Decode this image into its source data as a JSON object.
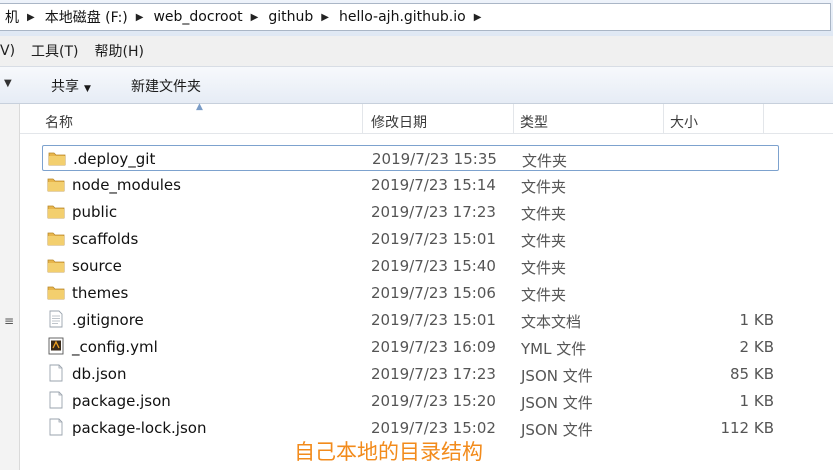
{
  "address": {
    "crumbs": [
      "机",
      "本地磁盘 (F:)",
      "web_docroot",
      "github",
      "hello-ajh.github.io"
    ]
  },
  "menu": {
    "view_partial": "V)",
    "tools": "工具(T)",
    "help": "帮助(H)"
  },
  "toolbar": {
    "share": "共享",
    "new_folder": "新建文件夹"
  },
  "columns": {
    "name": "名称",
    "date": "修改日期",
    "type": "类型",
    "size": "大小"
  },
  "files": [
    {
      "name": ".deploy_git",
      "date": "2019/7/23 15:35",
      "type": "文件夹",
      "size": "",
      "icon": "folder-icon"
    },
    {
      "name": "node_modules",
      "date": "2019/7/23 15:14",
      "type": "文件夹",
      "size": "",
      "icon": "folder-icon"
    },
    {
      "name": "public",
      "date": "2019/7/23 17:23",
      "type": "文件夹",
      "size": "",
      "icon": "folder-icon"
    },
    {
      "name": "scaffolds",
      "date": "2019/7/23 15:01",
      "type": "文件夹",
      "size": "",
      "icon": "folder-icon"
    },
    {
      "name": "source",
      "date": "2019/7/23 15:40",
      "type": "文件夹",
      "size": "",
      "icon": "folder-icon"
    },
    {
      "name": "themes",
      "date": "2019/7/23 15:06",
      "type": "文件夹",
      "size": "",
      "icon": "folder-icon"
    },
    {
      "name": ".gitignore",
      "date": "2019/7/23 15:01",
      "type": "文本文档",
      "size": "1 KB",
      "icon": "text-file-icon"
    },
    {
      "name": "_config.yml",
      "date": "2019/7/23 16:09",
      "type": "YML 文件",
      "size": "2 KB",
      "icon": "yml-file-icon"
    },
    {
      "name": "db.json",
      "date": "2019/7/23 17:23",
      "type": "JSON 文件",
      "size": "85 KB",
      "icon": "blank-file-icon"
    },
    {
      "name": "package.json",
      "date": "2019/7/23 15:20",
      "type": "JSON 文件",
      "size": "1 KB",
      "icon": "blank-file-icon"
    },
    {
      "name": "package-lock.json",
      "date": "2019/7/23 15:02",
      "type": "JSON 文件",
      "size": "112 KB",
      "icon": "blank-file-icon"
    }
  ],
  "annotation": "自己本地的目录结构",
  "colors": {
    "annotation": "#f28b1c",
    "focus_border": "#7da2ce",
    "folder": "#e8b64c"
  }
}
